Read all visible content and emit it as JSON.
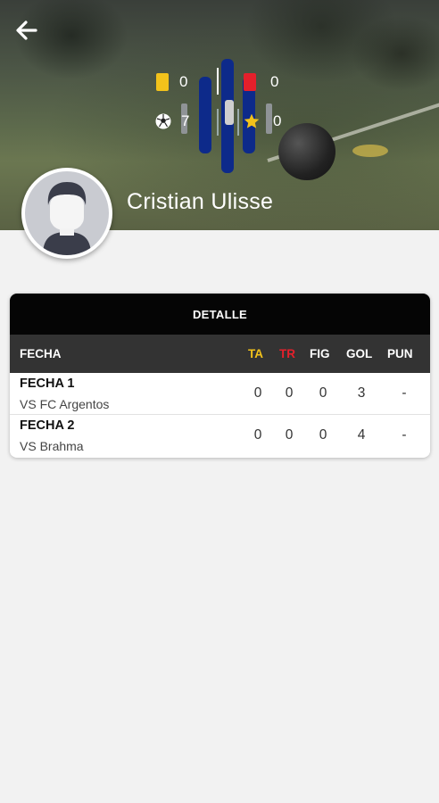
{
  "player": {
    "name": "Cristian Ulisse"
  },
  "stats": {
    "yellow_cards": "0",
    "red_cards": "0",
    "goals": "7",
    "stars": "0"
  },
  "table": {
    "title": "DETALLE",
    "columns": {
      "fecha": "FECHA",
      "ta": "TA",
      "tr": "TR",
      "fig": "FIG",
      "gol": "GOL",
      "pun": "PUN"
    },
    "rows": [
      {
        "fecha": "FECHA 1",
        "vs": "VS FC Argentos",
        "ta": "0",
        "tr": "0",
        "fig": "0",
        "gol": "3",
        "pun": "-"
      },
      {
        "fecha": "FECHA 2",
        "vs": "VS Brahma",
        "ta": "0",
        "tr": "0",
        "fig": "0",
        "gol": "4",
        "pun": "-"
      }
    ]
  },
  "colors": {
    "ta_header": "#f2c21b",
    "tr_header": "#e4202b",
    "logo_blue": "#0d2a8a",
    "title_bar": "#050505",
    "header_bar": "#333333"
  },
  "icons": {
    "back": "arrow-left-icon",
    "yellow_card": "yellow-card-icon",
    "red_card": "red-card-icon",
    "goals": "soccer-ball-icon",
    "stars": "star-icon",
    "avatar": "avatar-placeholder-icon"
  }
}
